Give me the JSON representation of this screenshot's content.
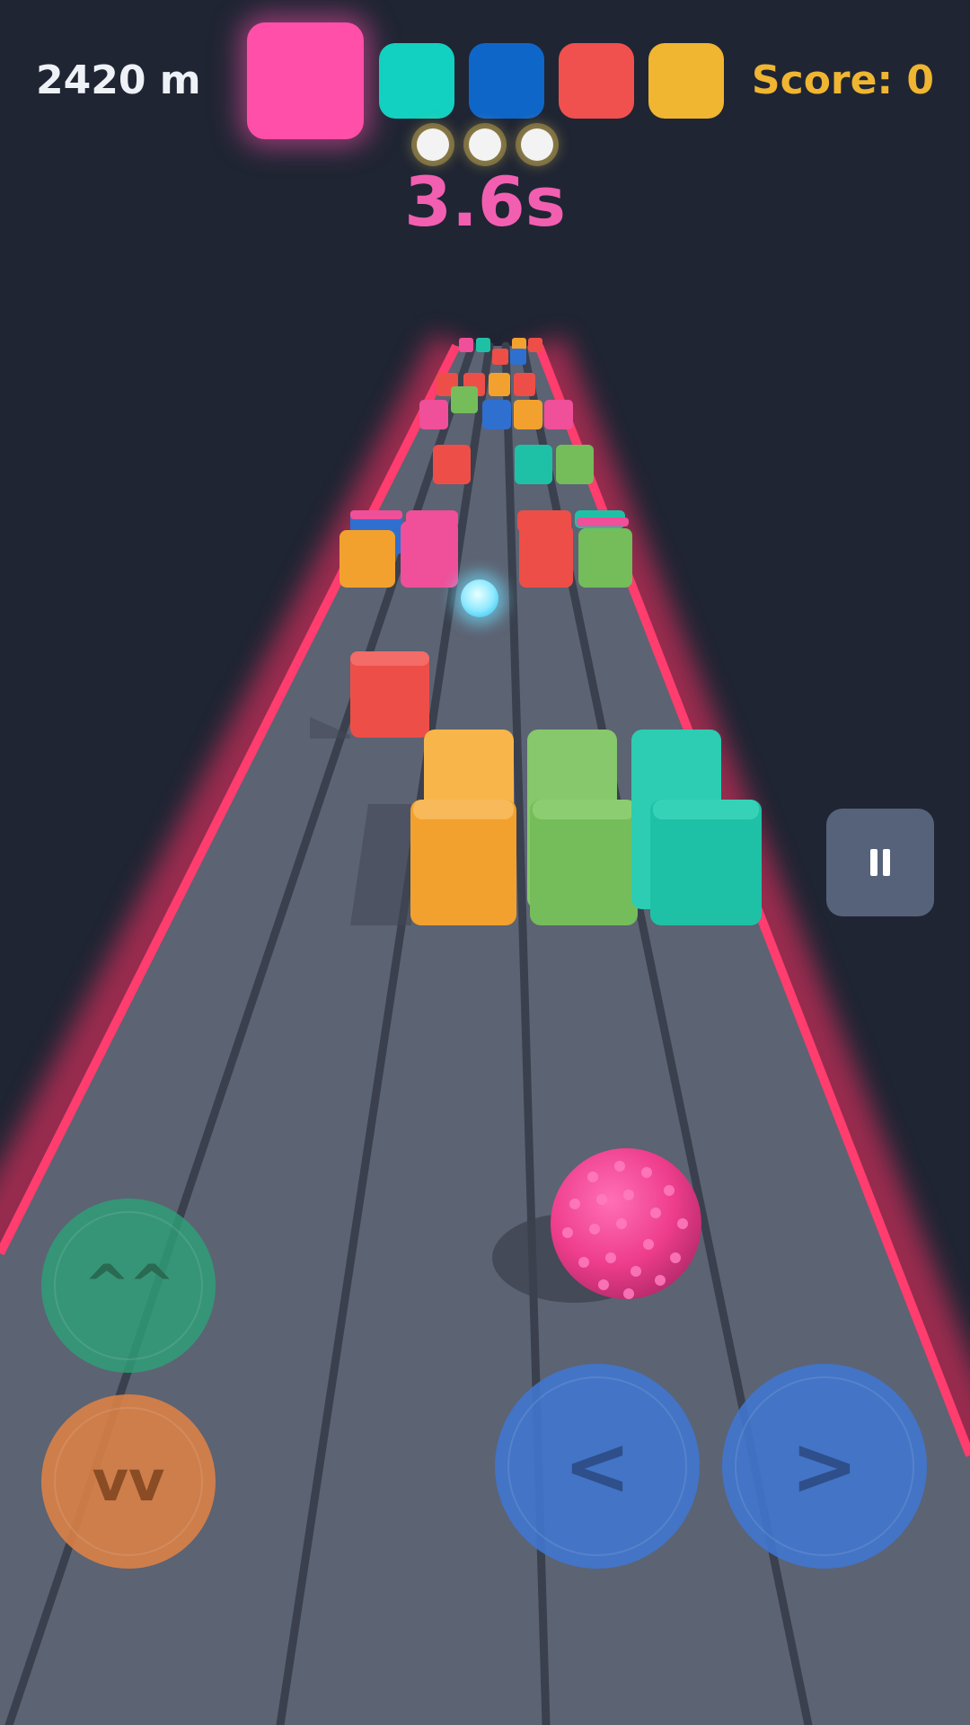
{
  "hud": {
    "distance": "2420 m",
    "score": "Score: 0",
    "timer": "3.6s",
    "lives": 3
  },
  "color_palette": {
    "active": "#ff4fa9",
    "options": [
      "#12d1c0",
      "#0f66c9",
      "#f0504e",
      "#f0b531"
    ]
  },
  "controls": {
    "jump_label": "^^",
    "duck_label": "vv",
    "left_label": "<",
    "right_label": ">",
    "pause_icon": "pause-icon"
  },
  "scene": {
    "track_color": "#5c6373",
    "edge_glow_color": "#ff3366",
    "background_color": "#1f2533",
    "player_color": "#f0428f",
    "orb_color": "#9ff0ff",
    "block_colors": {
      "pink": "#f04f9a",
      "teal": "#1fc1a6",
      "blue": "#2f6fd0",
      "red": "#ee4e48",
      "orange": "#f2a12e",
      "green": "#74bd5a"
    }
  }
}
